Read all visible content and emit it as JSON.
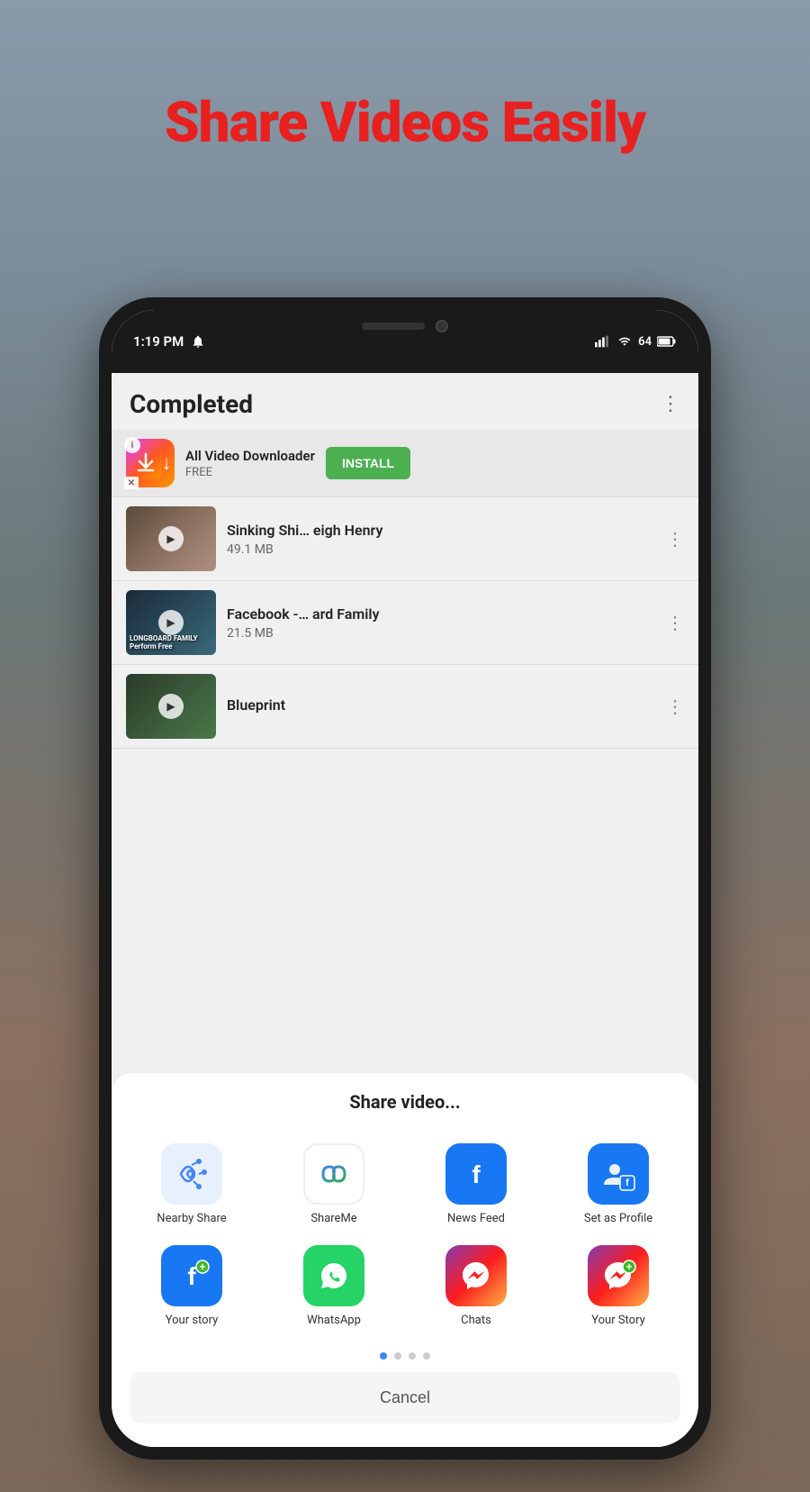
{
  "page": {
    "title": "Share Videos Easily",
    "background_gradient": "linear-gradient(180deg, #8a9aaa 0%, #7a8a96 20%, #6b7878 40%, #8a7060 70%, #7a6858 100%)"
  },
  "status_bar": {
    "time": "1:19 PM",
    "battery": "64",
    "bell_icon": "bell-icon",
    "wifi_icon": "wifi-icon",
    "signal_icon": "signal-icon",
    "battery_icon": "battery-icon"
  },
  "screen": {
    "header_title": "Completed",
    "menu_icon": "more-vertical-icon"
  },
  "ad": {
    "app_name": "All Video Downloader",
    "app_subtitle": "FREE",
    "install_label": "INSTALL",
    "info_icon": "info-icon",
    "close_icon": "close-icon"
  },
  "videos": [
    {
      "name": "Sinking Shi… eigh Henry",
      "size": "49.1 MB",
      "thumb_style": "video-thumb-1"
    },
    {
      "name": "Facebook -… ard Family",
      "size": "21.5 MB",
      "thumb_style": "video-thumb-2",
      "thumb_label": "LONGBOARD FAMILY"
    },
    {
      "name": "Blueprint",
      "size": "",
      "thumb_style": "video-thumb-3"
    }
  ],
  "share_sheet": {
    "title": "Share video...",
    "items": [
      {
        "label": "Nearby Share",
        "icon_type": "nearby",
        "color": "#e8f0fe"
      },
      {
        "label": "ShareMe",
        "icon_type": "shareme",
        "color": "gradient"
      },
      {
        "label": "News Feed",
        "icon_type": "facebook-news",
        "color": "#1877f2"
      },
      {
        "label": "Set as Profile",
        "icon_type": "set-profile",
        "color": "#1877f2"
      },
      {
        "label": "Your story",
        "icon_type": "your-story-fb",
        "color": "#1877f2"
      },
      {
        "label": "WhatsApp",
        "icon_type": "whatsapp",
        "color": "#25d366"
      },
      {
        "label": "Chats",
        "icon_type": "messenger",
        "color": "gradient-messenger"
      },
      {
        "label": "Your Story",
        "icon_type": "your-story-messenger",
        "color": "gradient-messenger"
      }
    ],
    "cancel_label": "Cancel",
    "dots": [
      true,
      false,
      false,
      false
    ]
  }
}
